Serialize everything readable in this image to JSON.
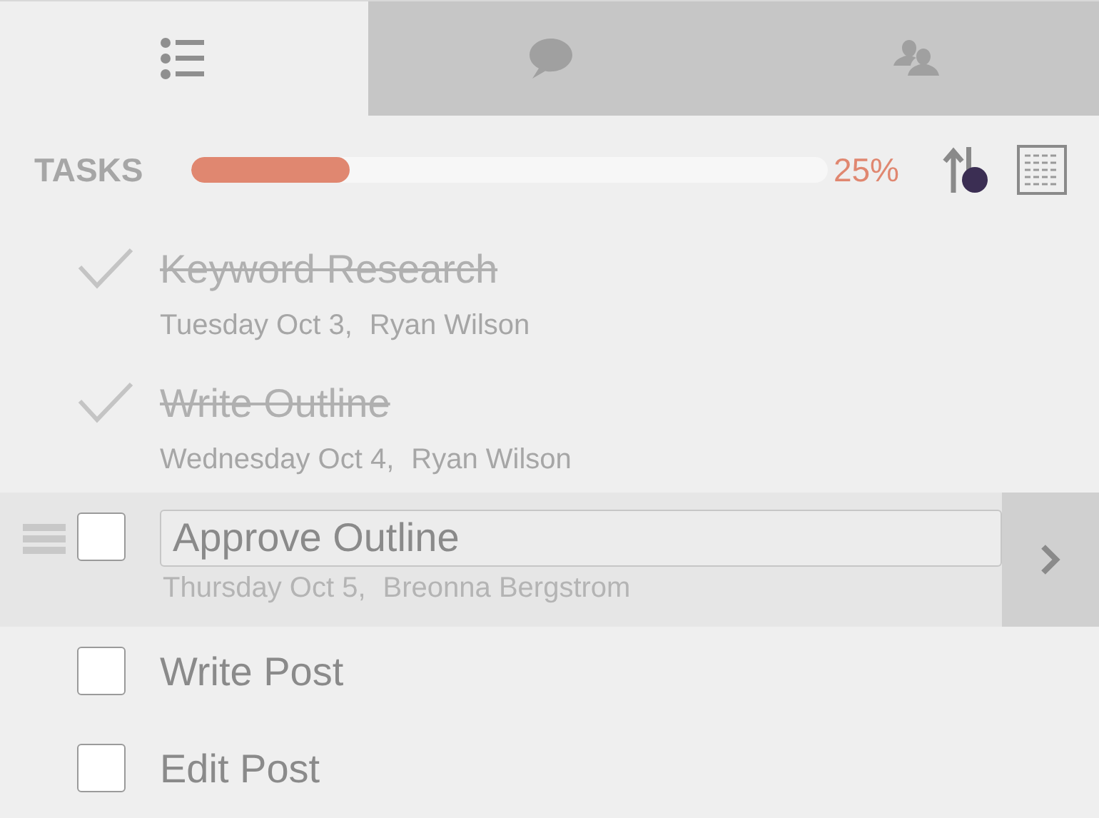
{
  "tabs": [
    {
      "kind": "list",
      "selected": true
    },
    {
      "kind": "chat",
      "selected": false
    },
    {
      "kind": "people",
      "selected": false
    }
  ],
  "header": {
    "label": "TASKS",
    "level": 0.25,
    "reading": "25%"
  },
  "tasks": [
    {
      "title": "Keyword Research",
      "date": "Tuesday Oct 3,",
      "assignee": "Ryan Wilson",
      "checked": true,
      "selected": false
    },
    {
      "title": "Write Outline",
      "date": "Wednesday Oct 4,",
      "assignee": "Ryan Wilson",
      "checked": true,
      "selected": false
    },
    {
      "title": "Approve Outline",
      "date": "Thursday Oct 5,",
      "assignee": "Breonna Bergstrom",
      "checked": false,
      "selected": true
    },
    {
      "title": "Write Post",
      "checked": false,
      "selected": false
    },
    {
      "title": "Edit Post",
      "checked": false,
      "selected": false
    }
  ]
}
